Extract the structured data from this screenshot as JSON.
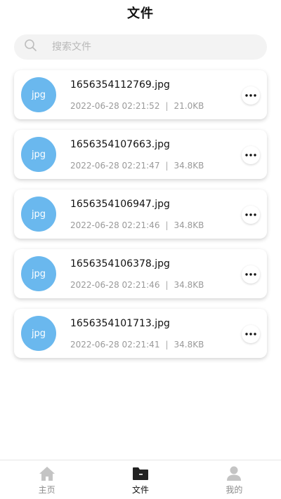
{
  "header": {
    "title": "文件"
  },
  "search": {
    "placeholder": "搜索文件"
  },
  "files": [
    {
      "type_label": "jpg",
      "name": "1656354112769.jpg",
      "date": "2022-06-28 02:21:52",
      "size": "21.0KB"
    },
    {
      "type_label": "jpg",
      "name": "1656354107663.jpg",
      "date": "2022-06-28 02:21:47",
      "size": "34.8KB"
    },
    {
      "type_label": "jpg",
      "name": "1656354106947.jpg",
      "date": "2022-06-28 02:21:46",
      "size": "34.8KB"
    },
    {
      "type_label": "jpg",
      "name": "1656354106378.jpg",
      "date": "2022-06-28 02:21:46",
      "size": "34.8KB"
    },
    {
      "type_label": "jpg",
      "name": "1656354101713.jpg",
      "date": "2022-06-28 02:21:41",
      "size": "34.8KB"
    }
  ],
  "meta_separator": "|",
  "tabbar": {
    "active": "files",
    "items": [
      {
        "id": "home",
        "label": "主页",
        "icon": "home-icon"
      },
      {
        "id": "files",
        "label": "文件",
        "icon": "folder-icon"
      },
      {
        "id": "mine",
        "label": "我的",
        "icon": "user-icon"
      }
    ]
  },
  "colors": {
    "thumb": "#6ab8ee",
    "tab_inactive": "#c4c4c4",
    "tab_active": "#222222"
  }
}
